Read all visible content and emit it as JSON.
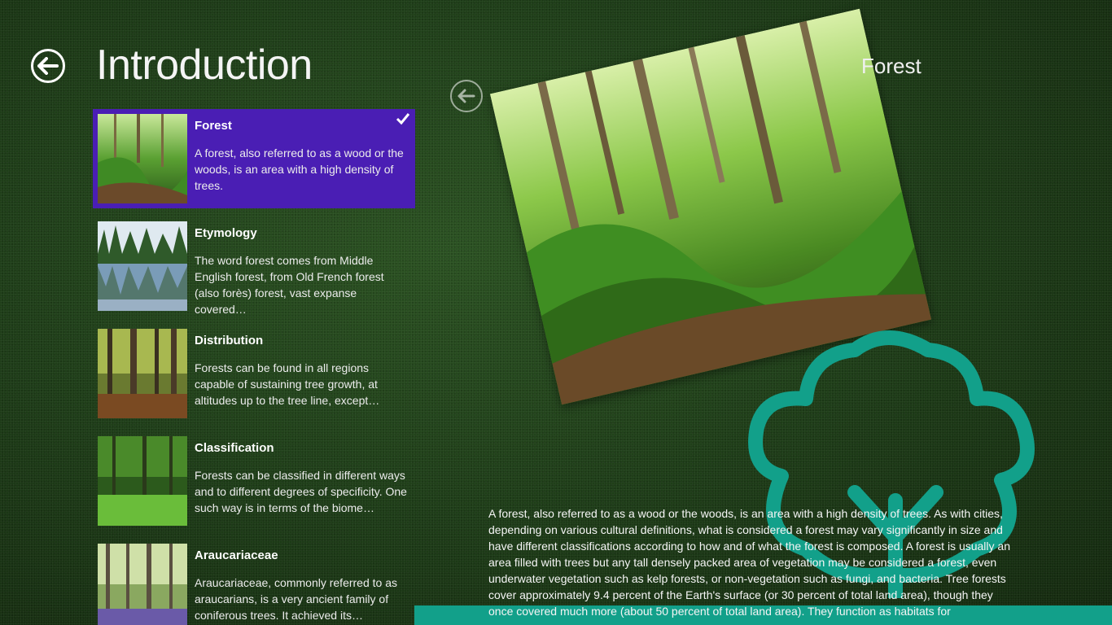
{
  "header": {
    "title": "Introduction"
  },
  "items": [
    {
      "title": "Forest",
      "desc": "A forest, also referred to as a wood or the woods, is an area with a high density of trees.",
      "selected": true
    },
    {
      "title": "Etymology",
      "desc": "The word forest comes from Middle English forest, from Old French forest (also forès) forest, vast expanse covered…"
    },
    {
      "title": "Distribution",
      "desc": "Forests can be found in all regions capable of sustaining tree growth, at altitudes up to the tree line, except…"
    },
    {
      "title": "Classification",
      "desc": "Forests can be classified in different ways and to different degrees of specificity. One such way is in terms of the biome…"
    },
    {
      "title": "Araucariaceae",
      "desc": "Araucariaceae, commonly referred to as araucarians, is a very ancient family of coniferous trees. It achieved its…"
    }
  ],
  "detail": {
    "title": "Forest",
    "body": "A forest, also referred to as a wood or the woods, is an area with a high density of trees. As with cities, depending on various cultural definitions, what is considered a forest may vary significantly in size and have different classifications according to how and of what the forest is composed. A forest is usually an area filled with trees but any tall densely packed area of vegetation may be considered a forest, even underwater vegetation such as kelp forests, or non-vegetation such as fungi, and bacteria. Tree forests cover approximately 9.4 percent of the Earth's surface (or 30 percent of total land area), though they once covered much more (about 50 percent of total land area). They function as habitats for"
  },
  "colors": {
    "selected": "#4a1eb4",
    "accent": "#12a08a"
  },
  "icons": {
    "back": "back-arrow-icon",
    "check": "checkmark-icon",
    "tree": "tree-outline-icon"
  }
}
